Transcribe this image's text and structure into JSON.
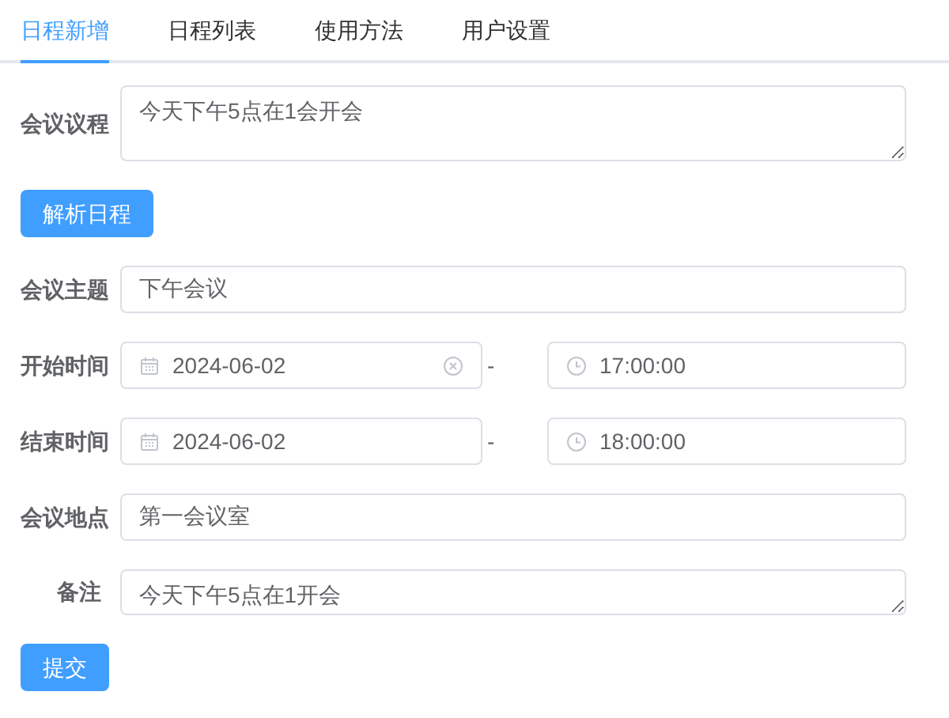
{
  "tabs": [
    {
      "label": "日程新增",
      "selected": true
    },
    {
      "label": "日程列表",
      "selected": false
    },
    {
      "label": "使用方法",
      "selected": false
    },
    {
      "label": "用户设置",
      "selected": false
    }
  ],
  "form": [
    {
      "kind": "textarea",
      "label": "会议议程",
      "value": "今天下午5点在1会开会",
      "tall": true
    },
    {
      "kind": "button",
      "label": "解析日程"
    },
    {
      "kind": "input",
      "label": "会议主题",
      "value": "下午会议"
    },
    {
      "kind": "datetime",
      "label": "开始时间",
      "date": "2024-06-02",
      "separator": "-",
      "time": "17:00:00",
      "clear_shown": true
    },
    {
      "kind": "datetime",
      "label": "结束时间",
      "date": "2024-06-02",
      "separator": "-",
      "time": "18:00:00",
      "clear_shown": false
    },
    {
      "kind": "input",
      "label": "会议地点",
      "value": "第一会议室"
    },
    {
      "kind": "textarea",
      "label": "备注",
      "value": "今天下午5点在1开会",
      "tall": false
    },
    {
      "kind": "button",
      "label": "提交"
    }
  ]
}
